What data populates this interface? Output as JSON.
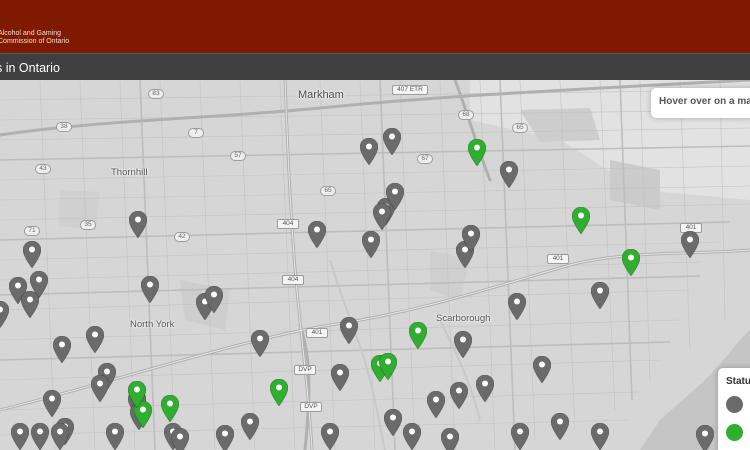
{
  "header": {
    "org_line1": "Alcohol and Gaming",
    "org_line2": "Commission of Ontario",
    "page_title": "s in Ontario",
    "brand_color": "#7f1a00"
  },
  "map": {
    "places": [
      {
        "name": "Markham",
        "major": true
      },
      {
        "name": "Thornhill",
        "major": false
      },
      {
        "name": "North York",
        "major": false
      },
      {
        "name": "Scarborough",
        "major": false
      }
    ],
    "shields": [
      "407 ETR",
      "404",
      "404",
      "401",
      "401",
      "401",
      "DVP",
      "DVP",
      "67",
      "68",
      "65",
      "65",
      "57",
      "7",
      "38",
      "83",
      "43",
      "42",
      "35",
      "71"
    ],
    "pin_colors": {
      "grey": "#6b6b6b",
      "green": "#2fae2f"
    },
    "pin_count": {
      "grey": 54,
      "green": 10
    }
  },
  "info_box": {
    "text": "Hover over on a ma"
  },
  "legend": {
    "title": "Statu",
    "items": [
      {
        "icon": "grey-circle",
        "color": "#6b6b6b"
      },
      {
        "icon": "green-circle",
        "color": "#2fae2f"
      }
    ]
  }
}
